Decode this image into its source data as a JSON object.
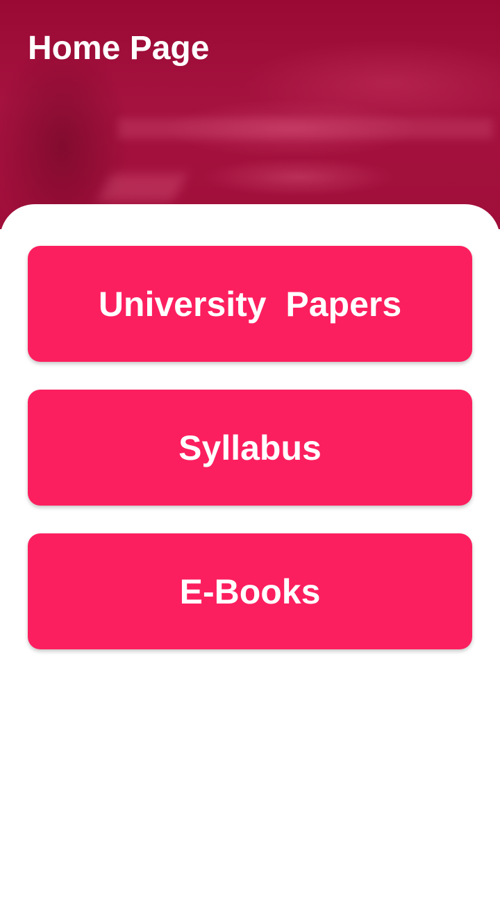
{
  "header": {
    "title": "Home Page"
  },
  "menu": {
    "items": [
      {
        "label": "University  Papers"
      },
      {
        "label": "Syllabus"
      },
      {
        "label": "E-Books"
      }
    ]
  },
  "colors": {
    "header_background": "#9e0a37",
    "button_background": "#fc1f5f",
    "button_text": "#ffffff",
    "card_background": "#ffffff"
  }
}
